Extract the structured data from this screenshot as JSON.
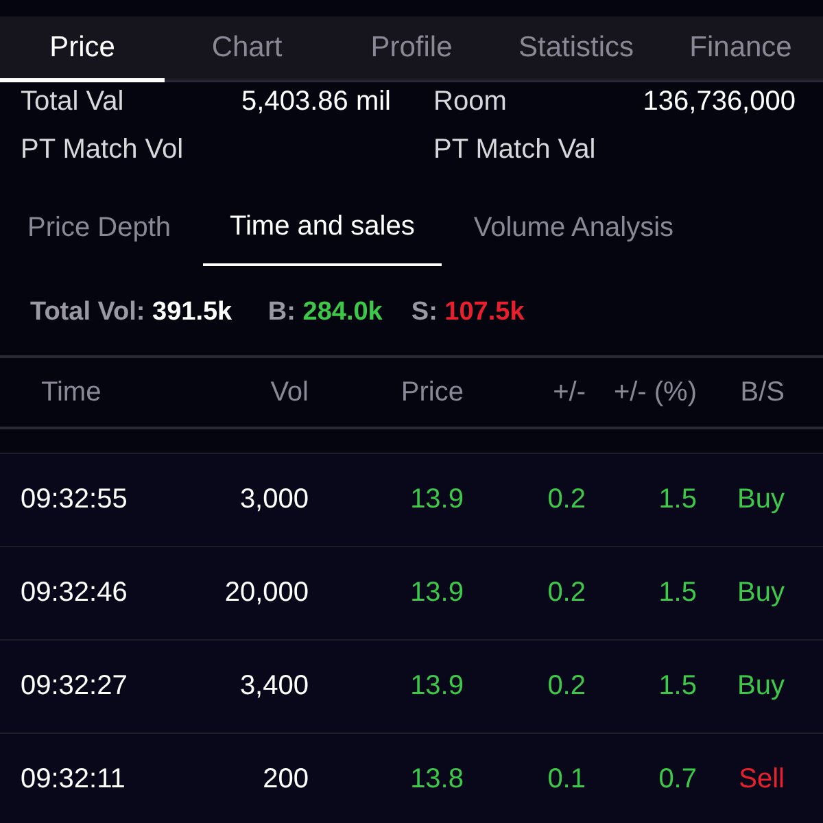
{
  "tabs": [
    {
      "label": "Price",
      "selected": true
    },
    {
      "label": "Chart",
      "selected": false
    },
    {
      "label": "Profile",
      "selected": false
    },
    {
      "label": "Statistics",
      "selected": false
    },
    {
      "label": "Finance",
      "selected": false
    }
  ],
  "stats": [
    {
      "label": "Total Val",
      "value": "5,403.86 mil"
    },
    {
      "label": "Room",
      "value": "136,736,000"
    },
    {
      "label": "PT Match Vol"
    },
    {
      "label": "PT Match Val"
    }
  ],
  "subtabs": [
    {
      "label": "Price Depth",
      "selected": false
    },
    {
      "label": "Time and sales",
      "selected": true
    },
    {
      "label": "Volume Analysis",
      "selected": false
    }
  ],
  "summary": {
    "total_label": "Total Vol:",
    "total": "391.5k",
    "buy_label": "B:",
    "buy": "284.0k",
    "sell_label": "S:",
    "sell": "107.5k"
  },
  "table": {
    "columns": [
      "Time",
      "Vol",
      "Price",
      "+/-",
      "+/- (%)",
      "B/S"
    ],
    "rows": [
      {
        "time": "09:32:55",
        "vol": "3,000",
        "price": "13.9",
        "change": "0.2",
        "change_pct": "1.5",
        "side": "Buy",
        "color": "#3ec84a",
        "kind": "buy"
      },
      {
        "time": "09:32:46",
        "vol": "20,000",
        "price": "13.9",
        "change": "0.2",
        "change_pct": "1.5",
        "side": "Buy",
        "color": "#3ec84a",
        "kind": "buy"
      },
      {
        "time": "09:32:27",
        "vol": "3,400",
        "price": "13.9",
        "change": "0.2",
        "change_pct": "1.5",
        "side": "Buy",
        "color": "#3ec84a",
        "kind": "buy"
      },
      {
        "time": "09:32:11",
        "vol": "200",
        "price": "13.8",
        "change": "0.1",
        "change_pct": "0.7",
        "side": "Sell",
        "color": "#3ec84a",
        "kind": "sell"
      }
    ]
  }
}
